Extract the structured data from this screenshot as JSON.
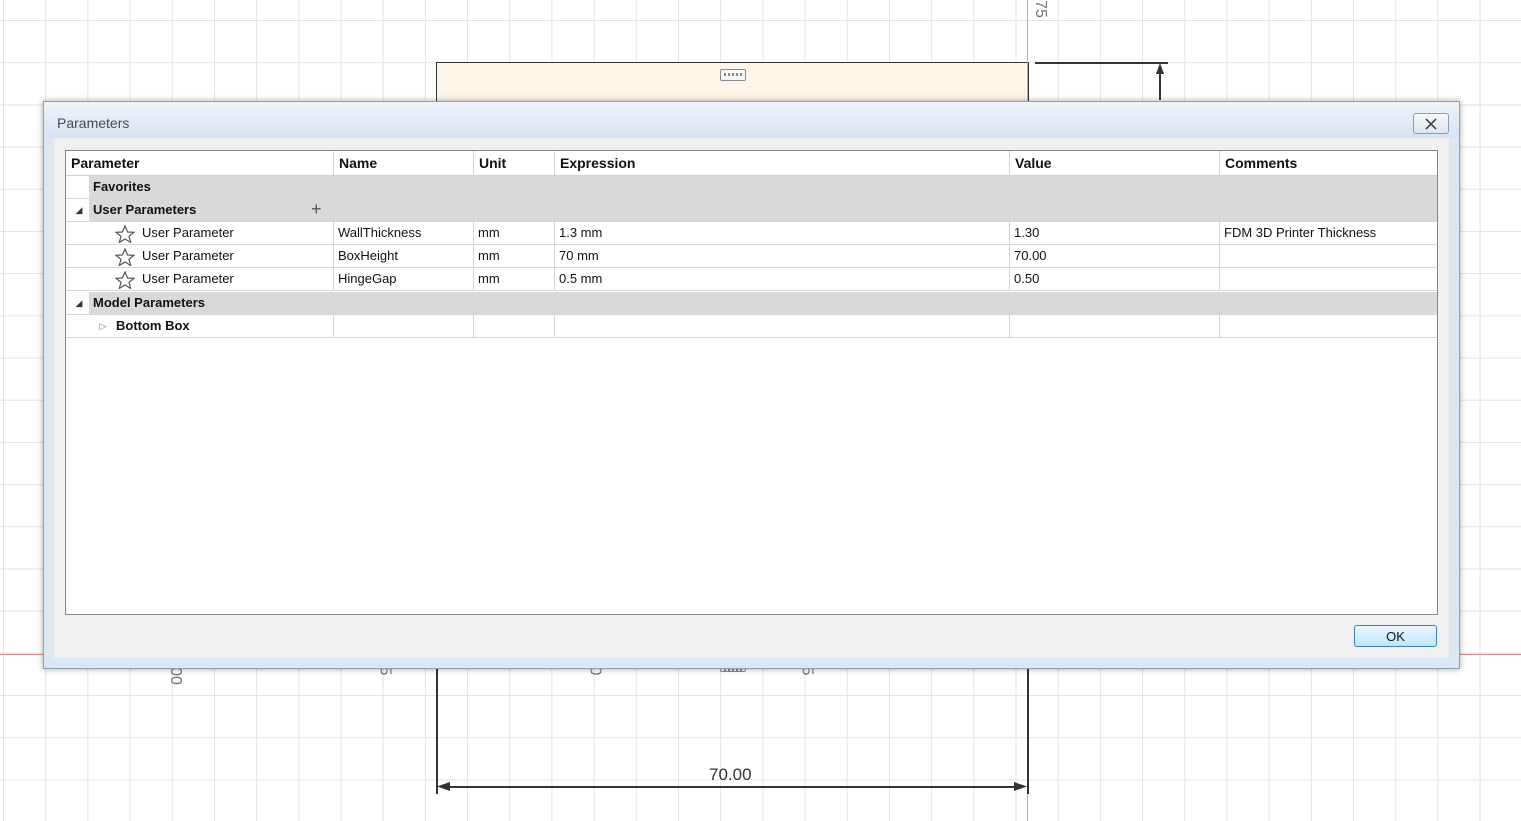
{
  "canvas": {
    "top_axis_label": "75",
    "bottom_axis_labels": [
      "00",
      "5",
      "0",
      "5"
    ],
    "dimension_label": "70.00"
  },
  "dialog": {
    "title": "Parameters",
    "ok_label": "OK",
    "columns": [
      "Parameter",
      "Name",
      "Unit",
      "Expression",
      "Value",
      "Comments"
    ],
    "groups": {
      "favorites": "Favorites",
      "user_parameters": "User Parameters",
      "model_parameters": "Model Parameters",
      "bottom_box": "Bottom Box"
    },
    "rows": [
      {
        "parameter": "User Parameter",
        "name": "WallThickness",
        "unit": "mm",
        "expression": "1.3 mm",
        "value": "1.30",
        "comments": "FDM 3D Printer Thickness"
      },
      {
        "parameter": "User Parameter",
        "name": "BoxHeight",
        "unit": "mm",
        "expression": "70 mm",
        "value": "70.00",
        "comments": ""
      },
      {
        "parameter": "User Parameter",
        "name": "HingeGap",
        "unit": "mm",
        "expression": "0.5 mm",
        "value": "0.50",
        "comments": ""
      }
    ]
  }
}
